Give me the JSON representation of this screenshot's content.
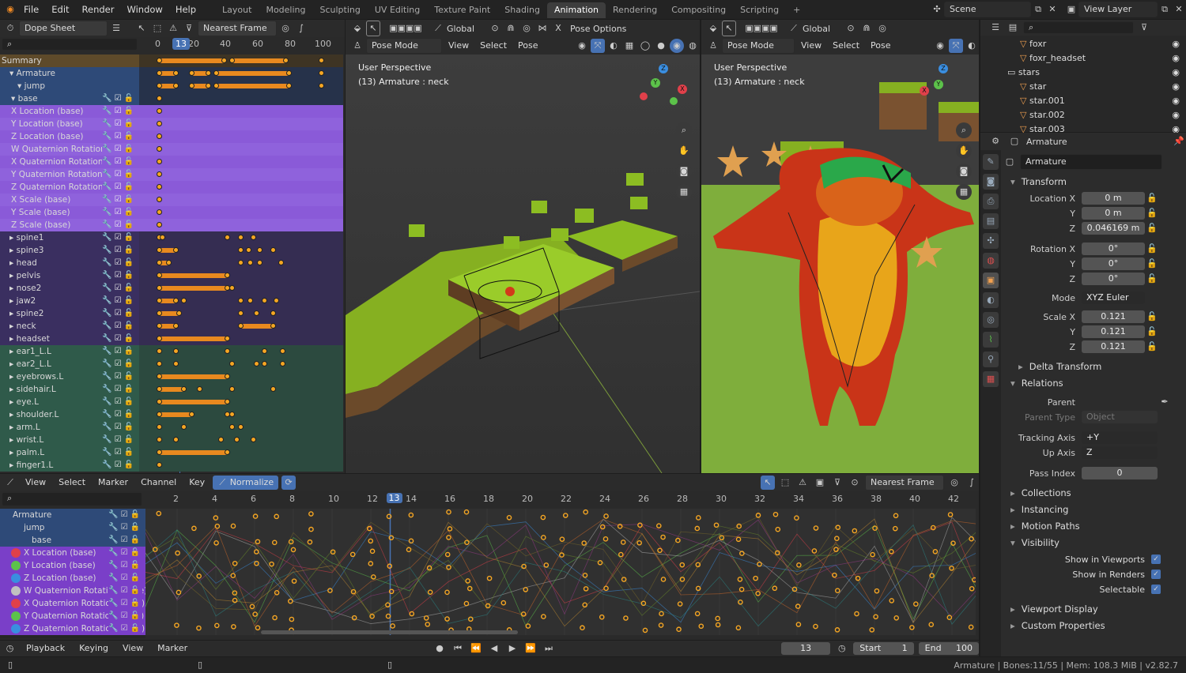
{
  "menubar": {
    "items": [
      "File",
      "Edit",
      "Render",
      "Window",
      "Help"
    ],
    "workspaces": [
      "Layout",
      "Modeling",
      "Sculpting",
      "UV Editing",
      "Texture Paint",
      "Shading",
      "Animation",
      "Rendering",
      "Compositing",
      "Scripting"
    ],
    "active_workspace": "Animation",
    "add_tab": "+",
    "scene": "Scene",
    "view_layer": "View Layer"
  },
  "dopesheet": {
    "mode": "Dope Sheet",
    "snap": "Nearest Frame",
    "ruler": [
      "0",
      "20",
      "40",
      "60",
      "80",
      "100"
    ],
    "current_frame": "13",
    "channels": [
      {
        "label": "Summary",
        "type": "summary"
      },
      {
        "label": "Armature",
        "type": "object"
      },
      {
        "label": "jump",
        "type": "action"
      },
      {
        "label": "base",
        "type": "group"
      },
      {
        "label": "X Location (base)",
        "type": "fcurve"
      },
      {
        "label": "Y Location (base)",
        "type": "fcurve"
      },
      {
        "label": "Z Location (base)",
        "type": "fcurve"
      },
      {
        "label": "W Quaternion Rotation (base)",
        "type": "fcurve"
      },
      {
        "label": "X Quaternion Rotation (base)",
        "type": "fcurve"
      },
      {
        "label": "Y Quaternion Rotation (base)",
        "type": "fcurve"
      },
      {
        "label": "Z Quaternion Rotation (base)",
        "type": "fcurve"
      },
      {
        "label": "X Scale (base)",
        "type": "fcurve"
      },
      {
        "label": "Y Scale (base)",
        "type": "fcurve"
      },
      {
        "label": "Z Scale (base)",
        "type": "fcurve"
      },
      {
        "label": "spine1",
        "type": "bone"
      },
      {
        "label": "spine3",
        "type": "bone"
      },
      {
        "label": "head",
        "type": "bone"
      },
      {
        "label": "pelvis",
        "type": "bone"
      },
      {
        "label": "nose2",
        "type": "bone"
      },
      {
        "label": "jaw2",
        "type": "bone"
      },
      {
        "label": "spine2",
        "type": "bone"
      },
      {
        "label": "neck",
        "type": "bone"
      },
      {
        "label": "headset",
        "type": "bone"
      },
      {
        "label": "ear1_L.L",
        "type": "boneL"
      },
      {
        "label": "ear2_L.L",
        "type": "boneL"
      },
      {
        "label": "eyebrows.L",
        "type": "boneL"
      },
      {
        "label": "sidehair.L",
        "type": "boneL"
      },
      {
        "label": "eye.L",
        "type": "boneL"
      },
      {
        "label": "shoulder.L",
        "type": "boneL"
      },
      {
        "label": "arm.L",
        "type": "boneL"
      },
      {
        "label": "wrist.L",
        "type": "boneL"
      },
      {
        "label": "palm.L",
        "type": "boneL"
      },
      {
        "label": "finger1.L",
        "type": "boneL"
      }
    ]
  },
  "viewport_left": {
    "pose_mode": "Pose Mode",
    "transform": "Global",
    "menus": [
      "View",
      "Select",
      "Pose"
    ],
    "options": "Pose Options",
    "perspective": "User Perspective",
    "info": "(13) Armature : neck"
  },
  "viewport_right": {
    "pose_mode": "Pose Mode",
    "transform": "Global",
    "menus": [
      "View",
      "Select",
      "Pose"
    ],
    "perspective": "User Perspective",
    "info": "(13) Armature : neck"
  },
  "outliner": {
    "items": [
      {
        "label": "foxr",
        "indent": 2
      },
      {
        "label": "foxr_headset",
        "indent": 2
      },
      {
        "label": "stars",
        "indent": 1
      },
      {
        "label": "star",
        "indent": 2
      },
      {
        "label": "star.001",
        "indent": 2
      },
      {
        "label": "star.002",
        "indent": 2
      },
      {
        "label": "star.003",
        "indent": 2
      }
    ]
  },
  "properties": {
    "object_name": "Armature",
    "datablock": "Armature",
    "transform_title": "Transform",
    "location": {
      "label_x": "Location X",
      "label_y": "Y",
      "label_z": "Z",
      "x": "0 m",
      "y": "0 m",
      "z": "0.046169 m"
    },
    "rotation": {
      "label_x": "Rotation X",
      "label_y": "Y",
      "label_z": "Z",
      "x": "0°",
      "y": "0°",
      "z": "0°"
    },
    "mode_label": "Mode",
    "mode": "XYZ Euler",
    "scale": {
      "label_x": "Scale X",
      "label_y": "Y",
      "label_z": "Z",
      "x": "0.121",
      "y": "0.121",
      "z": "0.121"
    },
    "delta": "Delta Transform",
    "relations": "Relations",
    "parent_label": "Parent",
    "parent_type_label": "Parent Type",
    "parent_type": "Object",
    "tracking_label": "Tracking Axis",
    "tracking": "+Y",
    "up_label": "Up Axis",
    "up": "Z",
    "pass_label": "Pass Index",
    "pass": "0",
    "collections": "Collections",
    "instancing": "Instancing",
    "motion_paths": "Motion Paths",
    "visibility": "Visibility",
    "show_viewports": "Show in Viewports",
    "show_renders": "Show in Renders",
    "selectable": "Selectable",
    "viewport_display": "Viewport Display",
    "custom_props": "Custom Properties"
  },
  "graph_editor": {
    "menus": [
      "View",
      "Select",
      "Marker",
      "Channel",
      "Key"
    ],
    "normalize": "Normalize",
    "snap": "Nearest Frame",
    "ruler": [
      "2",
      "4",
      "6",
      "8",
      "10",
      "12",
      "13",
      "14",
      "16",
      "18",
      "20",
      "22",
      "24",
      "26",
      "28",
      "30",
      "32",
      "34",
      "36",
      "38",
      "40",
      "42"
    ],
    "channels": [
      {
        "label": "Armature",
        "type": "object"
      },
      {
        "label": "jump",
        "type": "action"
      },
      {
        "label": "base",
        "type": "group"
      },
      {
        "label": "X Location (base)",
        "color": "#e0404a"
      },
      {
        "label": "Y Location (base)",
        "color": "#5cc24a"
      },
      {
        "label": "Z Location (base)",
        "color": "#3a8ee0"
      },
      {
        "label": "W Quaternion Rotation (base)",
        "color": "#c0c0c0"
      },
      {
        "label": "X Quaternion Rotation (base)",
        "color": "#e0404a"
      },
      {
        "label": "Y Quaternion Rotation (base)",
        "color": "#5cc24a"
      },
      {
        "label": "Z Quaternion Rotation (base)",
        "color": "#3a8ee0"
      }
    ]
  },
  "timeline": {
    "playback": "Playback",
    "keying": "Keying",
    "view": "View",
    "marker": "Marker",
    "frame": "13",
    "start_label": "Start",
    "start": "1",
    "end_label": "End",
    "end": "100"
  },
  "status": {
    "text": "Armature | Bones:11/55 | Mem: 108.3 MiB | v2.82.7"
  }
}
